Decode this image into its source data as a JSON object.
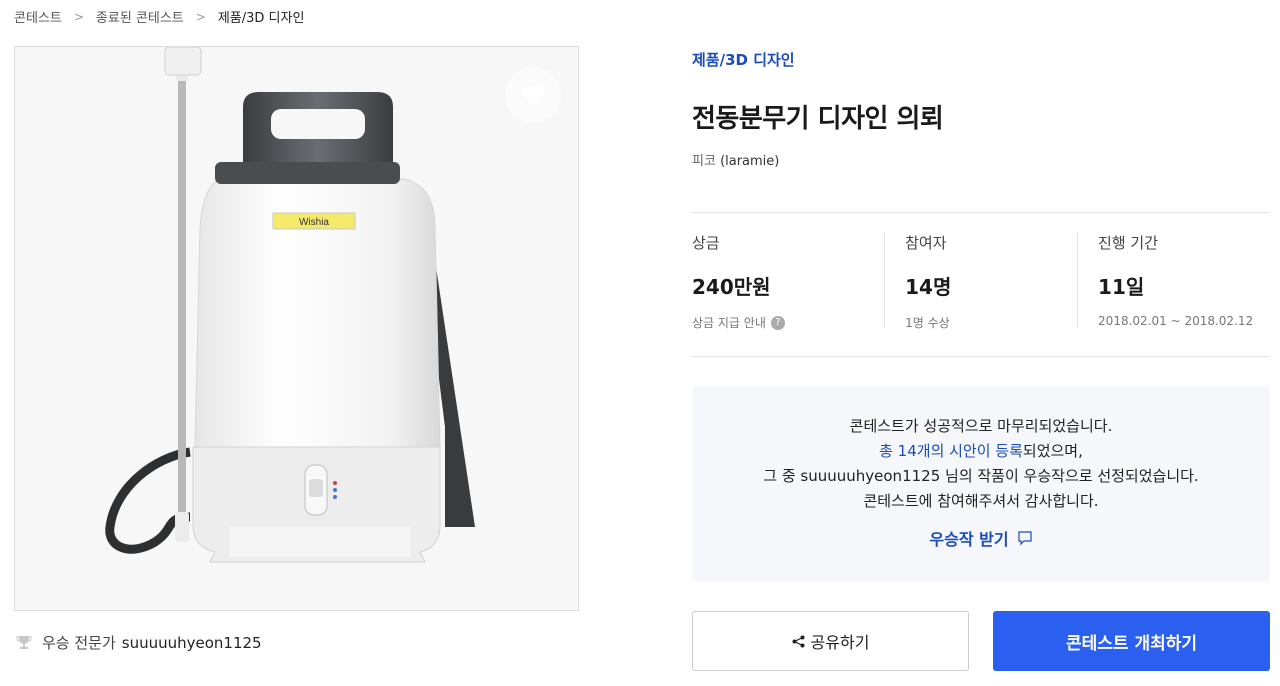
{
  "breadcrumb": {
    "items": [
      "콘테스트",
      "종료된 콘테스트",
      "제품/3D 디자인"
    ]
  },
  "product_image": {
    "label_text": "Wishia"
  },
  "winner": {
    "label": "우승 전문가",
    "name": "suuuuuhyeon1125"
  },
  "contest": {
    "category": "제품/3D 디자인",
    "title": "전동분무기 디자인 의뢰",
    "owner_name": "피코",
    "owner_handle": "(laramie)"
  },
  "stats": [
    {
      "label": "상금",
      "value": "240만원",
      "sub": "상금 지급 안내"
    },
    {
      "label": "참여자",
      "value": "14명",
      "sub": "1명 수상"
    },
    {
      "label": "진행 기간",
      "value": "11일",
      "sub": "2018.02.01 ~ 2018.02.12"
    }
  ],
  "result": {
    "line1": "콘테스트가 성공적으로 마무리되었습니다.",
    "line2_link": "총 14개의 시안이 등록",
    "line2_rest": "되었으며,",
    "line3_pre": "그 중 ",
    "line3_name": "suuuuuhyeon1125",
    "line3_post": " 님의 작품이 우승작으로 선정되었습니다.",
    "line4": "콘테스트에 참여해주셔서 감사합니다.",
    "get_prize": "우승작 받기"
  },
  "buttons": {
    "share": "공유하기",
    "host": "콘테스트 개최하기"
  },
  "colors": {
    "accent_blue": "#1a4db8",
    "primary_button": "#2b5ff0"
  }
}
